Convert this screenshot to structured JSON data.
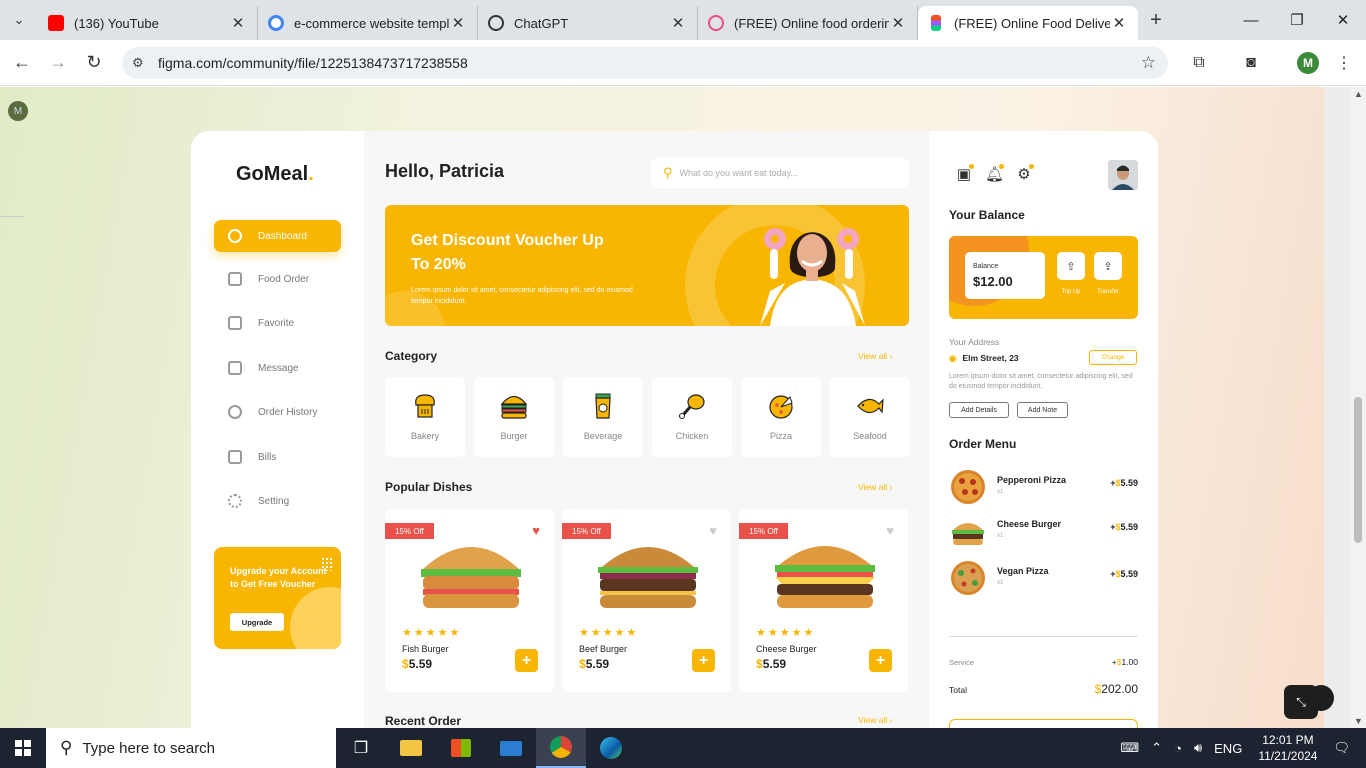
{
  "browser": {
    "tabs": [
      {
        "label": "(136) YouTube",
        "icon": "youtube-icon",
        "color": "#ff0000"
      },
      {
        "label": "e-commerce website templa",
        "icon": "google-icon",
        "color": "#4285f4"
      },
      {
        "label": "ChatGPT",
        "icon": "chatgpt-icon",
        "color": "#333333"
      },
      {
        "label": "(FREE) Online food ordering",
        "icon": "dribbble-icon",
        "color": "#ea4c89"
      },
      {
        "label": "(FREE) Online Food Delivery",
        "icon": "figma-icon",
        "color": "#f24e1e"
      }
    ],
    "url": "figma.com/community/file/1225138473717238558",
    "profile_initial": "M"
  },
  "app": {
    "logo": "GoMeal",
    "logo_dot": ".",
    "menu": [
      {
        "label": "Dashboard",
        "icon": "dashboard-icon"
      },
      {
        "label": "Food Order",
        "icon": "food-order-icon"
      },
      {
        "label": "Favorite",
        "icon": "favorite-icon"
      },
      {
        "label": "Message",
        "icon": "message-icon"
      },
      {
        "label": "Order History",
        "icon": "order-history-icon"
      },
      {
        "label": "Bills",
        "icon": "bills-icon"
      },
      {
        "label": "Setting",
        "icon": "gear-icon"
      }
    ],
    "upgrade": {
      "text": "Upgrade your Account to Get Free Voucher",
      "button": "Upgrade"
    },
    "greeting": "Hello, Patricia",
    "search_placeholder": "What do you want eat today...",
    "banner": {
      "title": "Get Discount Voucher Up To 20%",
      "text": "Lorem ipsum dolor sit amet, consectetur adipiscing elit, sed do eiusmod tempor incididunt."
    },
    "category": {
      "title": "Category",
      "view_all": "View all",
      "items": [
        {
          "label": "Bakery",
          "icon": "bakery-icon"
        },
        {
          "label": "Burger",
          "icon": "burger-icon"
        },
        {
          "label": "Beverage",
          "icon": "beverage-icon"
        },
        {
          "label": "Chicken",
          "icon": "chicken-icon"
        },
        {
          "label": "Pizza",
          "icon": "pizza-icon"
        },
        {
          "label": "Seafood",
          "icon": "seafood-icon"
        }
      ]
    },
    "popular": {
      "title": "Popular Dishes",
      "view_all": "View all",
      "dishes": [
        {
          "badge": "15% Off",
          "name": "Fish Burger",
          "currency": "$",
          "price": "5.59",
          "favorite": true,
          "rating": 5
        },
        {
          "badge": "15% Off",
          "name": "Beef Burger",
          "currency": "$",
          "price": "5.59",
          "favorite": false,
          "rating": 5
        },
        {
          "badge": "15% Off",
          "name": "Cheese Burger",
          "currency": "$",
          "price": "5.59",
          "favorite": false,
          "rating": 5
        }
      ]
    },
    "recent": {
      "title": "Recent Order",
      "view_all": "View all"
    },
    "right": {
      "balance_title": "Your Balance",
      "balance_label": "Balance",
      "balance_value": "$12.00",
      "top_up": "Top Up",
      "transfer": "Transfer",
      "address_label": "Your Address",
      "address": "Elm Street, 23",
      "change": "Change",
      "address_text": "Lorem ipsum dolor sit amet, consectetur adipiscing elit, sed do eiusmod tempor incididunt.",
      "add_details": "Add Details",
      "add_note": "Add Note",
      "order_title": "Order Menu",
      "orders": [
        {
          "name": "Pepperoni Pizza",
          "qty": "x1",
          "sign": "+",
          "currency": "$",
          "price": "5.59"
        },
        {
          "name": "Cheese Burger",
          "qty": "x1",
          "sign": "+",
          "currency": "$",
          "price": "5.59"
        },
        {
          "name": "Vegan Pizza",
          "qty": "x1",
          "sign": "+",
          "currency": "$",
          "price": "5.59"
        }
      ],
      "service_label": "Service",
      "service_sign": "+",
      "service_currency": "$",
      "service_value": "1.00",
      "total_label": "Total",
      "total_currency": "$",
      "total_value": "202.00"
    }
  },
  "taskbar": {
    "search": "Type here to search",
    "lang": "ENG",
    "time": "12:01 PM",
    "date": "11/21/2024"
  },
  "colors": {
    "accent": "#f8b602",
    "badge": "#e8524a"
  }
}
